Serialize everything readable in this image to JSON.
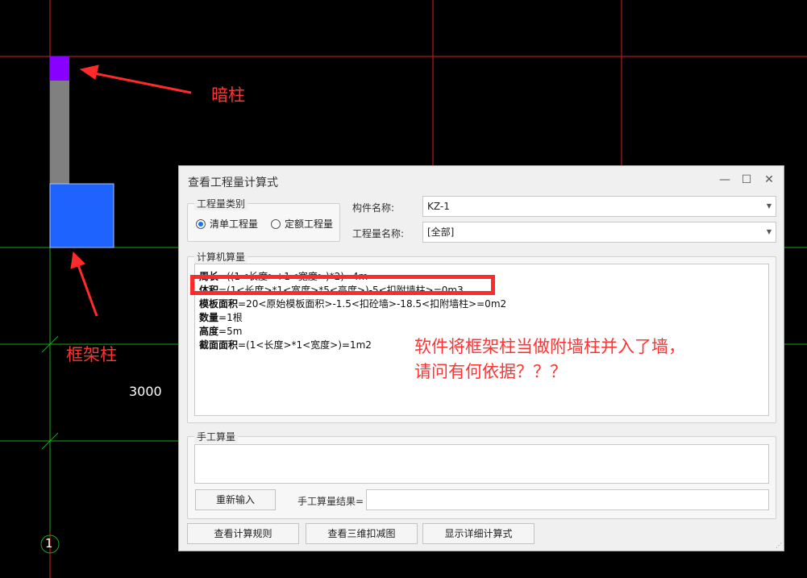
{
  "cad": {
    "label_dimension": "3000",
    "label_axis": "1",
    "label_hidden_column": "暗柱",
    "label_frame_column": "框架柱",
    "colors": {
      "grid_red": "#d91e1e",
      "grid_green": "#1fa31f",
      "hidden_column": "#8800ff",
      "frame_column": "#1f63ff",
      "wall": "#808080",
      "annotation": "#ff3333"
    }
  },
  "dialog": {
    "title": "查看工程量计算式",
    "controls": {
      "minimize": "—",
      "maximize": "☐",
      "close": "✕"
    },
    "quantity_type": {
      "legend": "工程量类别",
      "options": [
        {
          "label": "清单工程量",
          "selected": true
        },
        {
          "label": "定额工程量",
          "selected": false
        }
      ]
    },
    "component_name": {
      "label": "构件名称:",
      "value": "KZ-1"
    },
    "quantity_name": {
      "label": "工程量名称:",
      "value": "[全部]"
    },
    "computer_calc": {
      "legend": "计算机算量",
      "lines": [
        {
          "key": "周长",
          "expr": "=((1<长度>+1<宽度>)*2)=4m"
        },
        {
          "key": "体积",
          "expr": "=(1<长度>*1<宽度>*5<高度>)-5<扣附墙柱>=0m3"
        },
        {
          "key": "模板面积",
          "expr": "=20<原始模板面积>-1.5<扣砼墙>-18.5<扣附墙柱>=0m2"
        },
        {
          "key": "数量",
          "expr": "=1根"
        },
        {
          "key": "高度",
          "expr": "=5m"
        },
        {
          "key": "截面面积",
          "expr": "=(1<长度>*1<宽度>)=1m2"
        }
      ]
    },
    "annotation": {
      "line1": "软件将框架柱当做附墙柱并入了墙，",
      "line2": "请问有何依据？？？"
    },
    "manual_calc": {
      "legend": "手工算量",
      "input_text": "",
      "reenter_button": "重新输入",
      "result_label": "手工算量结果=",
      "result_value": ""
    },
    "bottom_buttons": [
      "查看计算规则",
      "查看三维扣减图",
      "显示详细计算式"
    ]
  }
}
